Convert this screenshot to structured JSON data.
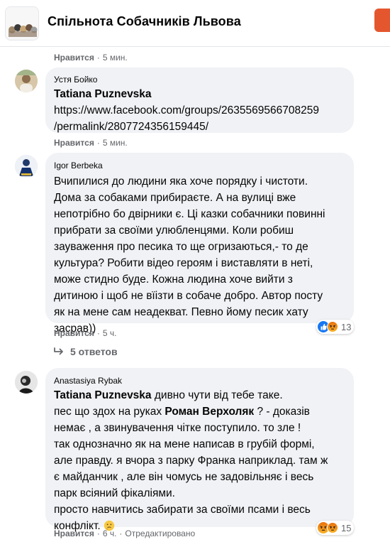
{
  "group": {
    "title": "Спільнота Собачників Львова"
  },
  "comments": [
    {
      "like": "Нравится",
      "time": "5 мин."
    },
    {
      "author": "Устя Бойко",
      "mention": "Tatiana Puznevska",
      "lines": [
        "https://www.facebook.com/groups/2635569566708259",
        "/permalink/2807724356159445/"
      ],
      "like": "Нравится",
      "time": "5 мин."
    },
    {
      "author": "Igor Berbeka",
      "lines": [
        "Вчипилися до людини яка хоче порядку і чистоти.",
        "Дома за собаками прибираєте. А на вулиці вже",
        "непотрібно бо двірники є. Ці казки собачники повинні",
        "прибрати за своїми улюбленцями. Коли робиш",
        "зауваження про песика то ще огризаються,- то де",
        "культура? Робити відео героям і виставляти в неті,",
        "може стидно буде. Кожна людина хоче вийти з",
        "дитиною і щоб не вїізти в собаче добро. Автор посту",
        "як на мене сам неадекват. Певно йому песик хату",
        "засрав))"
      ],
      "like": "Нравится",
      "time": "5 ч.",
      "reaction_count": "13",
      "replies_label": "5 ответов"
    },
    {
      "author": "Anastasiya Rybak",
      "mention": "Tatiana Puznevska",
      "first_line_rest": " дивно чути від тебе таке.",
      "line2_start": "пес що здох на руках ",
      "mention2": "Роман Верхоляк",
      "line2_rest": " ? - доказів",
      "lines": [
        "немає , а звинувачення чітке поступило. то зле !",
        "так однозначно як на мене написав в грубій формі,",
        "але правду. я вчора з парку Франка наприклад. там ж",
        "є майданчик , але він чомусь не задовільняє і весь",
        "парк всіяний фікаліями.",
        "просто навчитись забирати за своїми псами і весь",
        "конфлікт. "
      ],
      "like": "Нравится",
      "time": "6 ч.",
      "edited": "Отредактировано",
      "reaction_count": "15"
    }
  ],
  "colors": {
    "bubble": "#f0f2f5",
    "meta": "#65676b",
    "like_blue": "#1877f2",
    "angry": "#f7b125"
  },
  "icons": [
    "group-avatar",
    "like-reaction-icon",
    "angry-reaction-icon",
    "reply-arrow-icon",
    "thinking-emoji-icon"
  ]
}
